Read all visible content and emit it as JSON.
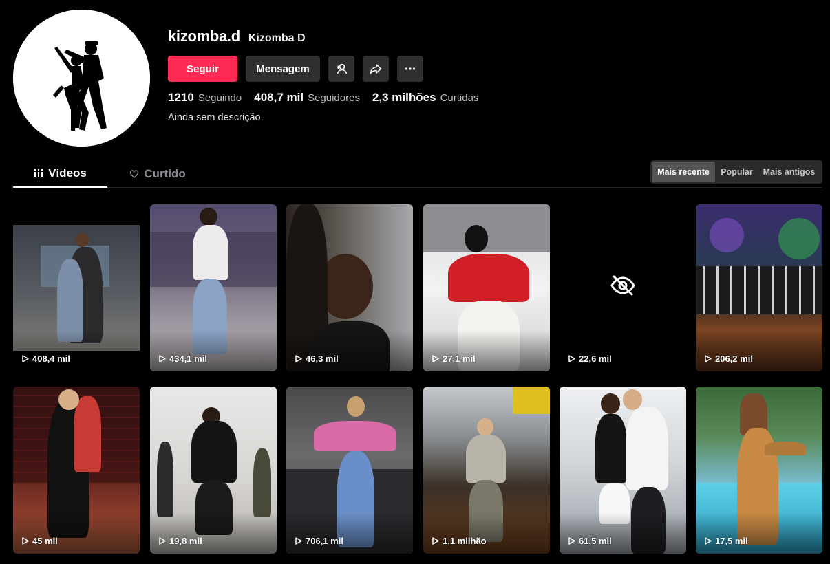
{
  "profile": {
    "username": "kizomba.d",
    "nickname": "Kizomba D",
    "bio": "Ainda sem descrição.",
    "follow_label": "Seguir",
    "message_label": "Mensagem",
    "stats": {
      "following_count": "1210",
      "following_label": "Seguindo",
      "followers_count": "408,7 mil",
      "followers_label": "Seguidores",
      "likes_count": "2,3 milhões",
      "likes_label": "Curtidas"
    }
  },
  "icons": [
    "add-friend-icon",
    "share-icon",
    "more-icon",
    "videos-grid-icon",
    "liked-heart-icon",
    "play-icon",
    "eye-off-icon"
  ],
  "colors": {
    "accent": "#fe2c55",
    "background": "#000000",
    "button_secondary": "#2f2f2f"
  },
  "tabs": [
    {
      "label": "Vídeos",
      "active": true
    },
    {
      "label": "Curtido",
      "active": false
    }
  ],
  "sort": {
    "options": [
      "Mais recente",
      "Popular",
      "Mais antigos"
    ],
    "selected": "Mais recente"
  },
  "videos": [
    {
      "views": "408,4 mil"
    },
    {
      "views": "434,1 mil"
    },
    {
      "views": "46,3 mil"
    },
    {
      "views": "27,1 mil"
    },
    {
      "views": "22,6 mil",
      "hidden": true
    },
    {
      "views": "206,2 mil"
    },
    {
      "views": "45 mil"
    },
    {
      "views": "19,8 mil"
    },
    {
      "views": "706,1 mil"
    },
    {
      "views": "1,1 milhão"
    },
    {
      "views": "61,5 mil"
    },
    {
      "views": "17,5 mil"
    }
  ]
}
